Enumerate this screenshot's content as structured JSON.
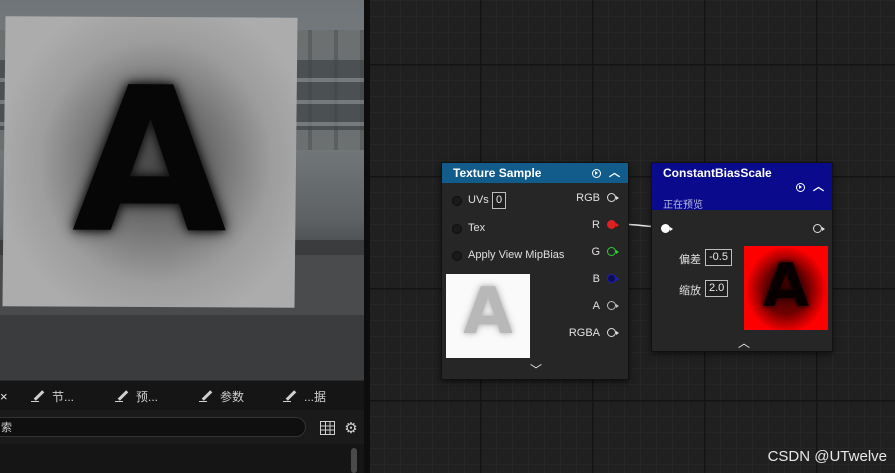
{
  "left_tabs": [
    {
      "label": "节...",
      "icon": "pencil-icon"
    },
    {
      "label": "预...",
      "icon": "pencil-icon"
    },
    {
      "label": "参数",
      "icon": "pencil-icon"
    },
    {
      "label": "...据",
      "icon": "pencil-icon"
    }
  ],
  "left_tab_close": "×",
  "search": {
    "value": "索",
    "placeholder": ""
  },
  "texture_sample": {
    "title": "Texture Sample",
    "inputs": [
      {
        "label": "UVs",
        "value": "0"
      },
      {
        "label": "Tex"
      },
      {
        "label": "Apply View MipBias"
      }
    ],
    "outputs": [
      {
        "label": "RGB",
        "color": "#e0e0e0"
      },
      {
        "label": "R",
        "color": "#e02020"
      },
      {
        "label": "G",
        "color": "#2fd12f"
      },
      {
        "label": "B",
        "color": "#1d1dc4"
      },
      {
        "label": "A",
        "color": "#bfbfbf"
      },
      {
        "label": "RGBA",
        "color": "#e0e0e0"
      }
    ],
    "preview_letter": "A",
    "header_color": "#125c8c"
  },
  "constant_bias_scale": {
    "title": "ConstantBiasScale",
    "subtitle": "正在预览",
    "params": [
      {
        "label": "偏差",
        "value": "-0.5"
      },
      {
        "label": "缩放",
        "value": "2.0"
      }
    ],
    "preview_letter": "A",
    "header_color": "#0a0a8c"
  },
  "viewport_letter": "A",
  "watermark": "CSDN @UTwelve"
}
